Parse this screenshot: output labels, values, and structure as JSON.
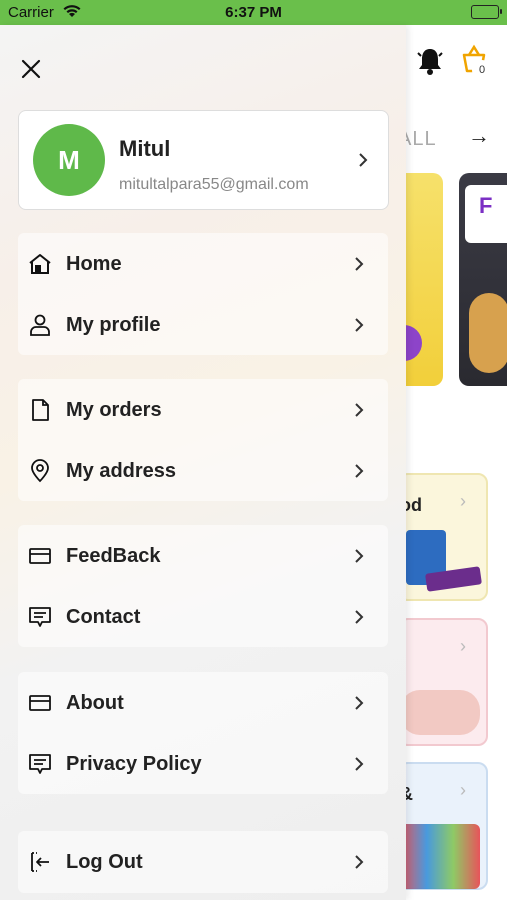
{
  "status_bar": {
    "carrier": "Carrier",
    "time": "6:37 PM"
  },
  "background_app": {
    "cart_count": "0",
    "view_all_label": "ALL",
    "banner_letter": "F",
    "categories": [
      {
        "label": "od"
      },
      {
        "label": ""
      },
      {
        "label": "&"
      }
    ]
  },
  "drawer": {
    "profile": {
      "initial": "M",
      "name": "Mitul",
      "email": "mitultalpara55@gmail.com"
    },
    "menu": {
      "home": "Home",
      "my_profile": "My profile",
      "my_orders": "My orders",
      "my_address": "My address",
      "feedback": "FeedBack",
      "contact": "Contact",
      "about": "About",
      "privacy_policy": "Privacy Policy",
      "log_out": "Log Out"
    }
  },
  "colors": {
    "accent": "#5fb94a",
    "status_bar": "#6abf4b",
    "bell": "#111111",
    "cart": "#f0a400"
  }
}
